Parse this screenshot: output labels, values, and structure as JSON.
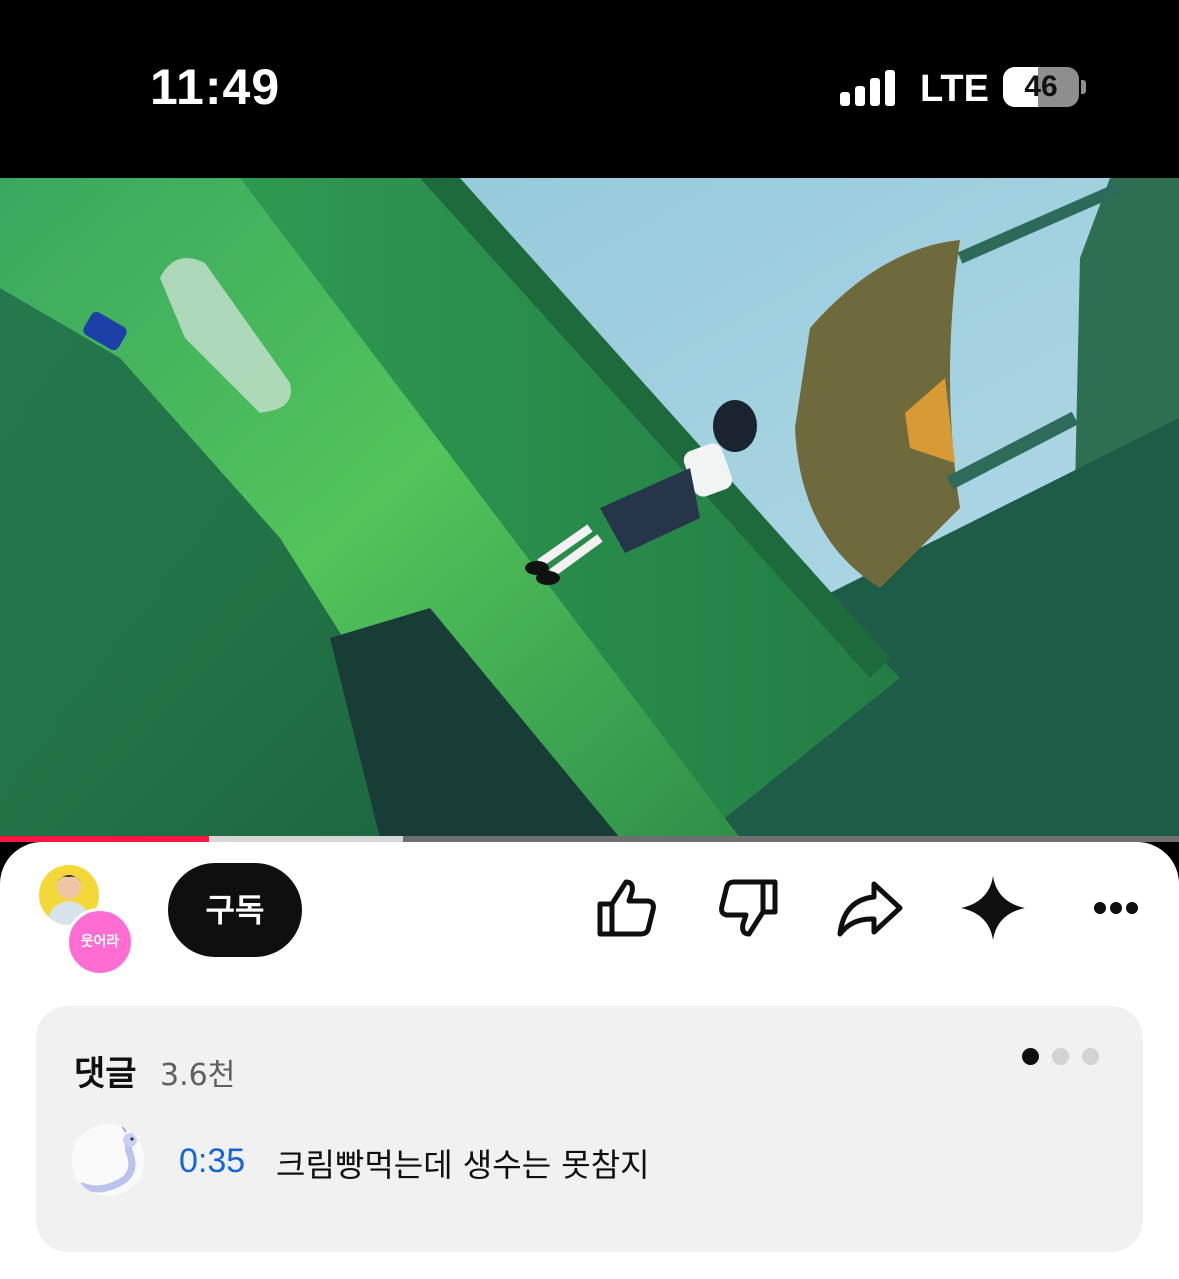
{
  "status_bar": {
    "time": "11:49",
    "network": "LTE",
    "battery": "46",
    "battery_level": 0.46,
    "signal_icon": "cellular-signal-icon"
  },
  "video": {
    "progress_played": 0.177,
    "progress_buffered": 0.342,
    "colors": {
      "played": "#ff1744",
      "buffered": "#d6d6d6",
      "track": "#6f6f6f"
    }
  },
  "channel": {
    "avatar_icon": "channel-avatar-icon",
    "collab_avatar_label": "웃어라"
  },
  "subscribe": {
    "label": "구독"
  },
  "actions": [
    {
      "name": "like-button",
      "icon": "thumbs-up-icon"
    },
    {
      "name": "dislike-button",
      "icon": "thumbs-down-icon"
    },
    {
      "name": "share-button",
      "icon": "share-arrow-icon"
    },
    {
      "name": "remix-button",
      "icon": "sparkle-icon"
    },
    {
      "name": "more-button",
      "icon": "more-horizontal-icon"
    }
  ],
  "comments": {
    "title": "댓글",
    "count": "3.6천",
    "page_dots": 3,
    "active_dot": 0,
    "top_comment": {
      "timestamp": "0:35",
      "text": "크림빵먹는데 생수는 못참지"
    }
  }
}
